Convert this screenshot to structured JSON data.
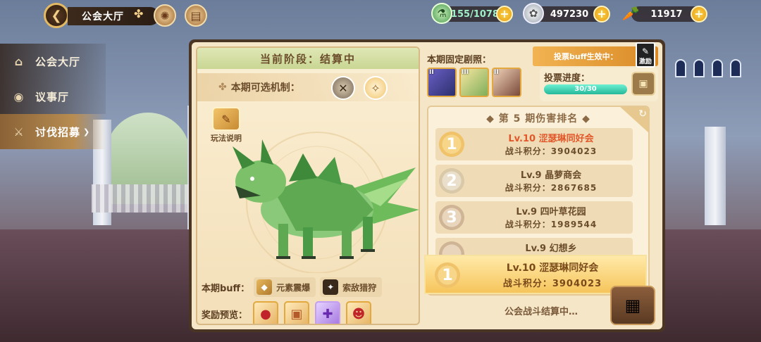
{
  "topbar": {
    "title": "公会大厅",
    "stamina": "155/1078",
    "silver": "497230",
    "carrots": "11917"
  },
  "sidebar": {
    "items": [
      {
        "label": "公会大厅",
        "icon": "hall-icon",
        "active": false
      },
      {
        "label": "议事厅",
        "icon": "eye-icon",
        "active": false
      },
      {
        "label": "讨伐招募",
        "icon": "battle-icon",
        "active": true
      }
    ]
  },
  "left": {
    "phase": "当前阶段：结算中",
    "mechanism_label": "本期可选机制：",
    "rules_label": "玩法说明",
    "buff_label": "本期buff：",
    "buffs": [
      "元素震爆",
      "索敌猎狩"
    ],
    "rewards_label": "奖励预览："
  },
  "right": {
    "fixed_label": "本期固定剧照：",
    "portrait_ranks": [
      "II",
      "III",
      "II"
    ],
    "vote_buff": "投票buff生效中：",
    "vote_badge": "激励",
    "vote_progress_label": "投票进度：",
    "vote_progress_text": "30/30",
    "vote_progress": 1.0,
    "ranking_title": "第 5 期伤害排名",
    "ranking": [
      {
        "rank": "1",
        "name": "Lv.10 涩瑟琳同好会",
        "score": "战斗积分：3904023"
      },
      {
        "rank": "2",
        "name": "Lv.9 晶萝商会",
        "score": "战斗积分：2867685"
      },
      {
        "rank": "3",
        "name": "Lv.9 四叶草花园",
        "score": "战斗积分：1989544"
      },
      {
        "rank": "",
        "name": "Lv.9 幻想乡",
        "score": ""
      }
    ],
    "my_guild": {
      "rank": "1",
      "name": "Lv.10 涩瑟琳同好会",
      "score": "战斗积分：3904023"
    },
    "settle_text": "公会战斗结算中…"
  }
}
